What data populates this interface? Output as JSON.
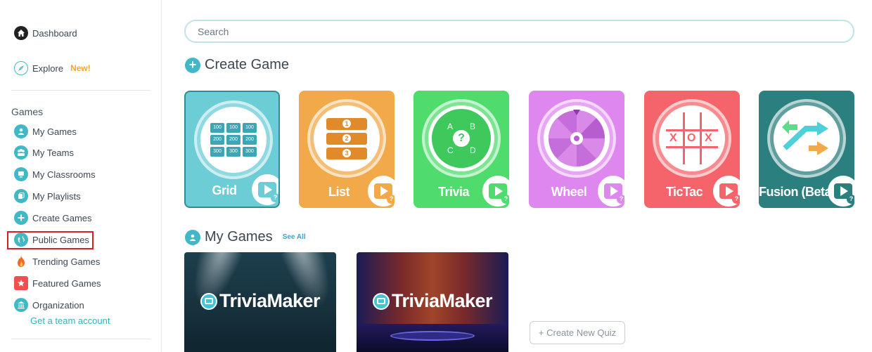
{
  "sidebar": {
    "dashboard": "Dashboard",
    "explore": "Explore",
    "new_badge": "New!",
    "section_title": "Games",
    "items": [
      {
        "label": "My Games",
        "icon": "user-icon"
      },
      {
        "label": "My Teams",
        "icon": "teams-icon"
      },
      {
        "label": "My Classrooms",
        "icon": "classroom-icon"
      },
      {
        "label": "My Playlists",
        "icon": "playlist-icon"
      },
      {
        "label": "Create Games",
        "icon": "plus-icon"
      },
      {
        "label": "Public Games",
        "icon": "globe-icon"
      },
      {
        "label": "Trending Games",
        "icon": "flame-icon"
      },
      {
        "label": "Featured Games",
        "icon": "star-icon"
      },
      {
        "label": "Organization",
        "icon": "building-icon"
      }
    ],
    "team_account": "Get a team account"
  },
  "search": {
    "placeholder": "Search"
  },
  "create_game": {
    "title": "Create Game",
    "cards": [
      {
        "label": "Grid",
        "color": "#6ccdd6"
      },
      {
        "label": "List",
        "color": "#f1a94a"
      },
      {
        "label": "Trivia",
        "color": "#4fdc6d"
      },
      {
        "label": "Wheel",
        "color": "#de88ef"
      },
      {
        "label": "TicTac",
        "color": "#f4646a"
      },
      {
        "label": "Fusion (Beta)",
        "color": "#2c7f7f"
      }
    ],
    "grid_values": [
      "100",
      "100",
      "100",
      "200",
      "200",
      "200",
      "300",
      "300",
      "300"
    ],
    "list_values": [
      "1",
      "2",
      "3"
    ],
    "trivia_letters": [
      "A",
      "B",
      "C",
      "D",
      "?"
    ],
    "tictac_letters": [
      "X",
      "O",
      "X"
    ]
  },
  "my_games": {
    "title": "My Games",
    "see_all": "See All",
    "quizzes": [
      {
        "brand": "TriviaMaker"
      },
      {
        "brand": "TriviaMaker"
      }
    ],
    "create_new": "+ Create New Quiz"
  }
}
